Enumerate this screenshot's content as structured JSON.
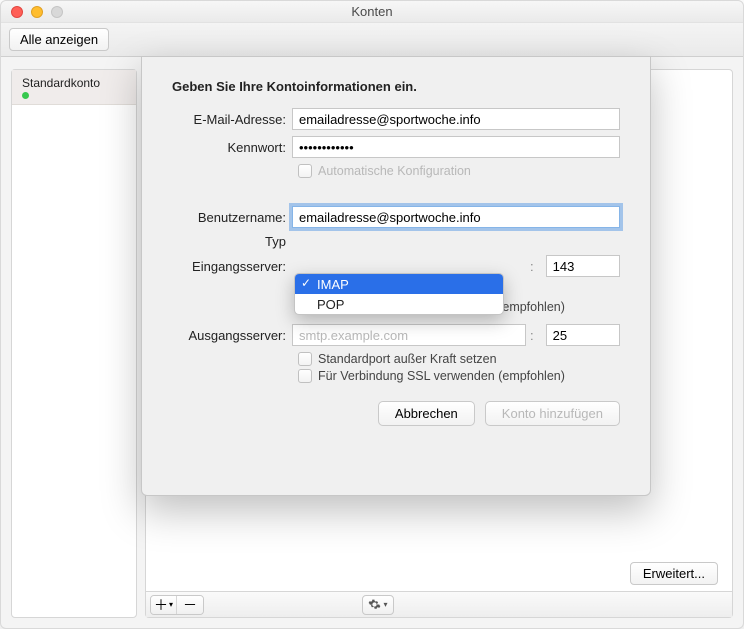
{
  "window": {
    "title": "Konten"
  },
  "toolbar": {
    "show_all": "Alle anzeigen"
  },
  "sidebar": {
    "account_name": "Standardkonto"
  },
  "sheet": {
    "heading": "Geben Sie Ihre Kontoinformationen ein.",
    "email_label": "E-Mail-Adresse:",
    "email_value": "emailadresse@sportwoche.info",
    "password_label": "Kennwort:",
    "password_value": "••••••••••••",
    "auto_config_label": "Automatische Konfiguration",
    "username_label": "Benutzername:",
    "username_value": "emailadresse@sportwoche.info",
    "type_label": "Typ",
    "type_options": {
      "imap": "IMAP",
      "pop": "POP"
    },
    "incoming_label": "Eingangsserver:",
    "incoming_port": "143",
    "override_port_label": "Standardport außer Kraft setzen",
    "ssl_label": "Für Verbindung SSL verwenden (empfohlen)",
    "outgoing_label": "Ausgangsserver:",
    "outgoing_placeholder": "smtp.example.com",
    "outgoing_port": "25",
    "cancel": "Abbrechen",
    "add": "Konto hinzufügen"
  },
  "footer": {
    "erweitert": "Erweitert..."
  }
}
